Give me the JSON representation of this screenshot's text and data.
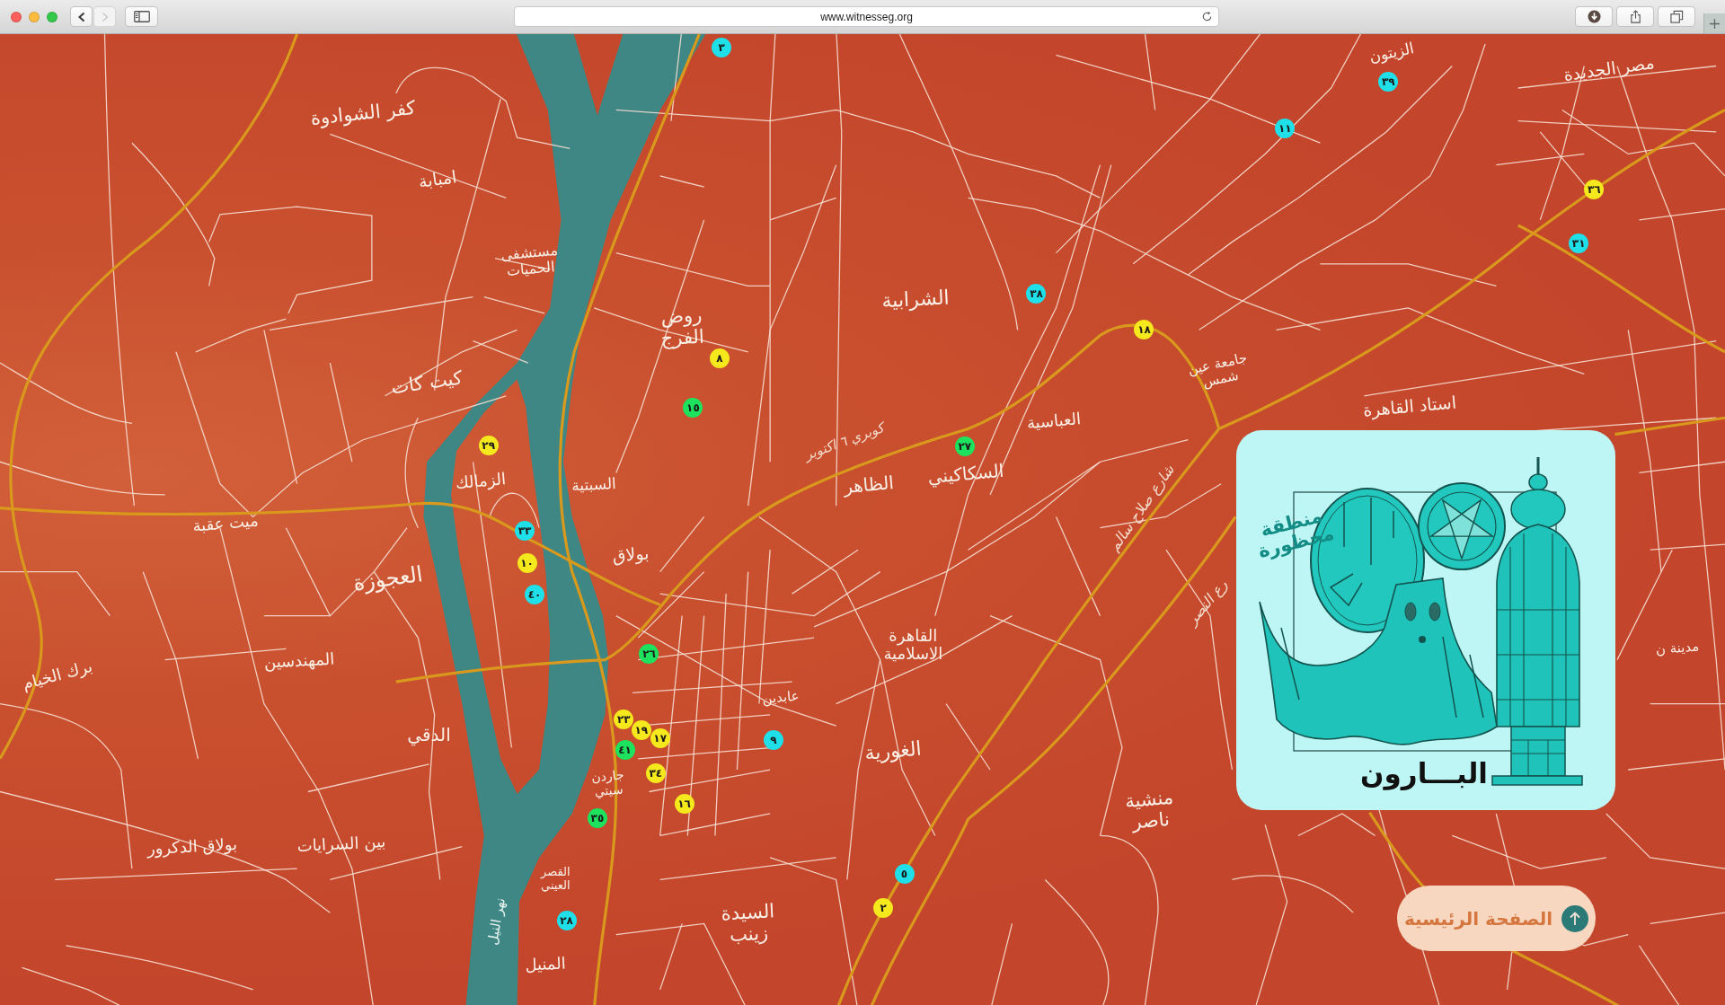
{
  "browser": {
    "url": "www.witnesseg.org",
    "nav_buttons": [
      {
        "kind": "back",
        "disabled": false
      },
      {
        "kind": "forward",
        "disabled": true
      }
    ]
  },
  "map": {
    "places": [
      {
        "name": "كفر الشوادوة",
        "kind": "district"
      },
      {
        "name": "امبابة",
        "kind": "district"
      },
      {
        "name": "مستشفى الحميات",
        "kind": "district"
      },
      {
        "name": "روض الفرج",
        "kind": "district"
      },
      {
        "name": "الشرابية",
        "kind": "district"
      },
      {
        "name": "الزيتون",
        "kind": "district"
      },
      {
        "name": "مصر الجديدة",
        "kind": "district"
      },
      {
        "name": "كيت كات",
        "kind": "district"
      },
      {
        "name": "الزمالك",
        "kind": "district"
      },
      {
        "name": "السبتية",
        "kind": "district"
      },
      {
        "name": "كوبري ٦ اكتوبر",
        "kind": "street"
      },
      {
        "name": "الظاهر",
        "kind": "district"
      },
      {
        "name": "السكاكيني",
        "kind": "district"
      },
      {
        "name": "العباسية",
        "kind": "district"
      },
      {
        "name": "جامعة عين شمس",
        "kind": "district"
      },
      {
        "name": "استاد القاهرة",
        "kind": "district"
      },
      {
        "name": "شارع صلاح سالم",
        "kind": "street"
      },
      {
        "name": "رع النصر",
        "kind": "street"
      },
      {
        "name": "مدينة ن",
        "kind": "district"
      },
      {
        "name": "ميت عقبة",
        "kind": "district"
      },
      {
        "name": "العجوزة",
        "kind": "district"
      },
      {
        "name": "المهندسين",
        "kind": "district"
      },
      {
        "name": "برك الخيام",
        "kind": "district"
      },
      {
        "name": "بولاق",
        "kind": "district"
      },
      {
        "name": "عابدين",
        "kind": "district"
      },
      {
        "name": "القاهرة الاسلامية",
        "kind": "district"
      },
      {
        "name": "الغورية",
        "kind": "district"
      },
      {
        "name": "الدقي",
        "kind": "district"
      },
      {
        "name": "جاردن سيتي",
        "kind": "district"
      },
      {
        "name": "بين السرايات",
        "kind": "district"
      },
      {
        "name": "بولاق الدكرور",
        "kind": "district"
      },
      {
        "name": "منشية ناصر",
        "kind": "district"
      },
      {
        "name": "القصر العيني",
        "kind": "district"
      },
      {
        "name": "السيدة زينب",
        "kind": "district"
      },
      {
        "name": "نهر النيل",
        "kind": "river"
      },
      {
        "name": "المنيل",
        "kind": "district"
      }
    ],
    "markers": [
      {
        "number": "٣",
        "color": "#1fdfe8"
      },
      {
        "number": "٣٩",
        "color": "#1fdfe8"
      },
      {
        "number": "١١",
        "color": "#1fdfe8"
      },
      {
        "number": "٣٦",
        "color": "#f5e81c"
      },
      {
        "number": "٣١",
        "color": "#1fdfe8"
      },
      {
        "number": "٣٨",
        "color": "#1fdfe8"
      },
      {
        "number": "١٨",
        "color": "#f5e81c"
      },
      {
        "number": "٨",
        "color": "#f5e81c"
      },
      {
        "number": "١٥",
        "color": "#1de25e"
      },
      {
        "number": "٢٩",
        "color": "#f5e81c"
      },
      {
        "number": "٢٧",
        "color": "#1de25e"
      },
      {
        "number": "٣٣",
        "color": "#1fdfe8"
      },
      {
        "number": "١٠",
        "color": "#f5e81c"
      },
      {
        "number": "٤٠",
        "color": "#1fdfe8"
      },
      {
        "number": "٢٦",
        "color": "#1de25e"
      },
      {
        "number": "٢٣",
        "color": "#f5e81c"
      },
      {
        "number": "١٩",
        "color": "#f5e81c"
      },
      {
        "number": "١٧",
        "color": "#f5e81c"
      },
      {
        "number": "٩",
        "color": "#1fdfe8"
      },
      {
        "number": "٤١",
        "color": "#1de25e"
      },
      {
        "number": "٣٤",
        "color": "#f5e81c"
      },
      {
        "number": "١٦",
        "color": "#f5e81c"
      },
      {
        "number": "٣٥",
        "color": "#1de25e"
      },
      {
        "number": "٥",
        "color": "#1fdfe8"
      },
      {
        "number": "٢",
        "color": "#f5e81c"
      },
      {
        "number": "٢٨",
        "color": "#1fdfe8"
      }
    ]
  },
  "card": {
    "title": "البـــارون",
    "caption": "منطقة محظورة"
  },
  "home_button": {
    "label": "الصفحة الرئيسية"
  }
}
